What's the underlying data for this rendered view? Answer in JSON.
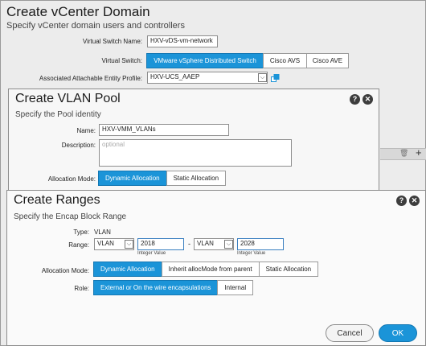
{
  "vcenter": {
    "title": "Create vCenter Domain",
    "subtitle": "Specify vCenter domain users and controllers",
    "vswitch_name_label": "Virtual Switch Name:",
    "vswitch_name_value": "HXV-vDS-vm-network",
    "vswitch_label": "Virtual Switch:",
    "vswitch_options": [
      "VMware vSphere Distributed Switch",
      "Cisco AVS",
      "Cisco AVE"
    ],
    "aaep_label": "Associated Attachable Entity Profile:",
    "aaep_value": "HXV-UCS_AAEP"
  },
  "vlan_pool": {
    "title": "Create VLAN Pool",
    "subtitle": "Specify the Pool identity",
    "name_label": "Name:",
    "name_value": "HXV-VMM_VLANs",
    "description_label": "Description:",
    "description_placeholder": "optional",
    "alloc_label": "Allocation Mode:",
    "alloc_options": [
      "Dynamic Allocation",
      "Static Allocation"
    ]
  },
  "ranges": {
    "title": "Create Ranges",
    "subtitle": "Specify the Encap Block Range",
    "type_label": "Type:",
    "type_value": "VLAN",
    "range_label": "Range:",
    "from_encap": "VLAN",
    "from_value": "2018",
    "dash": "-",
    "to_encap": "VLAN",
    "to_value": "2028",
    "hint_from": "Integer Value",
    "hint_to": "Integer Value",
    "alloc_label": "Allocation Mode:",
    "alloc_options": [
      "Dynamic Allocation",
      "Inherit allocMode from parent",
      "Static Allocation"
    ],
    "role_label": "Role:",
    "role_options": [
      "External or On the wire encapsulations",
      "Internal"
    ],
    "cancel_label": "Cancel",
    "ok_label": "OK"
  },
  "colors": {
    "accent": "#1b94d8",
    "ok_button": "#1b94d8"
  }
}
